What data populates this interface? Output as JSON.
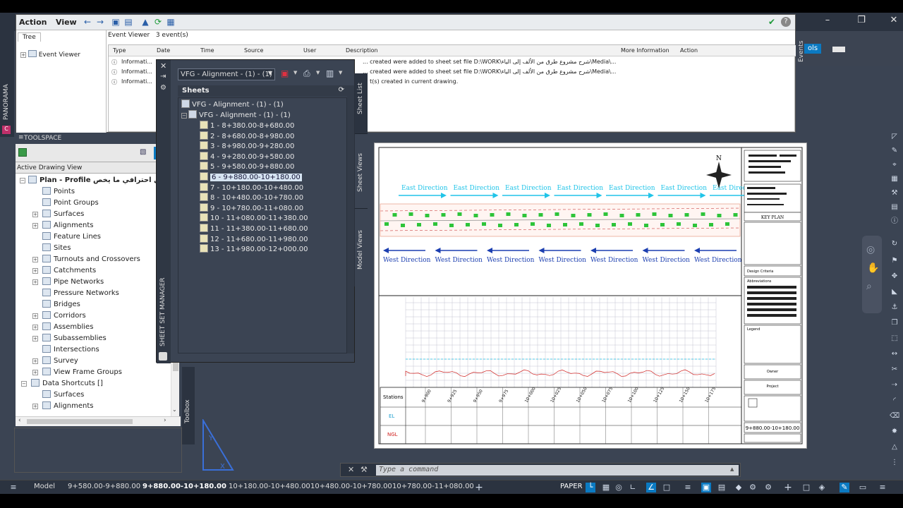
{
  "event_viewer": {
    "menu": {
      "action": "Action",
      "view": "View"
    },
    "tree_tab": "Tree",
    "tree_root": "Event Viewer",
    "header_title": "Event Viewer",
    "header_count": "3 event(s)",
    "columns": [
      "Type",
      "Date",
      "Time",
      "Source",
      "User",
      "Description",
      "More Information",
      "Action"
    ],
    "rows": [
      {
        "type": "Informati...",
        "description": "... created were added to sheet set file D:\\WORK\\شرح مشروع طرق من الألف إلى الياء\\Media\\..."
      },
      {
        "type": "Informati...",
        "description": "... created were added to sheet set file D:\\WORK\\شرح مشروع طرق من الألف إلى الياء\\Media\\..."
      },
      {
        "type": "Informati...",
        "description": "... t(s) created in current drawing."
      }
    ]
  },
  "ribbon": {
    "tab_label": "ols"
  },
  "panorama": {
    "label": "PANORAMA"
  },
  "toolspace": {
    "title": "TOOLSPACE",
    "view_title": "Active Drawing View",
    "root_label": "Plan - Profile بشكل احترافي ما يخص",
    "items": [
      "Points",
      "Point Groups",
      "Surfaces",
      "Alignments",
      "Feature Lines",
      "Sites",
      "Turnouts and Crossovers",
      "Catchments",
      "Pipe Networks",
      "Pressure Networks",
      "Bridges",
      "Corridors",
      "Assemblies",
      "Subassemblies",
      "Intersections",
      "Survey",
      "View Frame Groups"
    ],
    "shortcuts_label": "Data Shortcuts []",
    "shortcut_items": [
      "Surfaces",
      "Alignments"
    ]
  },
  "toolbox": {
    "label": "Toolbox"
  },
  "sheet_set": {
    "combo_value": "VFG - Alignment - (1) - (1)",
    "sheets_header": "Sheets",
    "root": "VFG - Alignment - (1) - (1)",
    "subset": "VFG - Alignment - (1) - (1)",
    "sheets": [
      "1 - 8+380.00-8+680.00",
      "2 - 8+680.00-8+980.00",
      "3 - 8+980.00-9+280.00",
      "4 - 9+280.00-9+580.00",
      "5 - 9+580.00-9+880.00",
      "6 - 9+880.00-10+180.00",
      "7 - 10+180.00-10+480.00",
      "8 - 10+480.00-10+780.00",
      "9 - 10+780.00-11+080.00",
      "10 - 11+080.00-11+380.00",
      "11 - 11+380.00-11+680.00",
      "12 - 11+680.00-11+980.00",
      "13 - 11+980.00-12+000.00"
    ],
    "selected_index": 5,
    "side_tabs": [
      "Sheet List",
      "Sheet Views",
      "Model Views"
    ],
    "manager_label": "SHEET SET MANAGER"
  },
  "drawing": {
    "east_labels": [
      "East Direction",
      "East Direction",
      "East Direction",
      "East Direction",
      "East Direction",
      "East Direction",
      "East Direction"
    ],
    "west_labels": [
      "West Direction",
      "West Direction",
      "West Direction",
      "West Direction",
      "West Direction",
      "West Direction",
      "West Direction"
    ],
    "north": "N",
    "key_plan": "KEY PLAN",
    "design_criteria": "Design Criteria",
    "abbreviations": "Abbreviations",
    "legend": "Legend",
    "owner": "Owner",
    "project": "Project",
    "stations_label": "Stations",
    "eg_label": "EL",
    "ngl_label": "NGL",
    "station_ticks": [
      "9+900",
      "9+925",
      "9+950",
      "9+975",
      "10+000",
      "10+025",
      "10+050",
      "10+075",
      "10+100",
      "10+125",
      "10+150",
      "10+175"
    ],
    "sheet_range": "9+880.00-10+180.00"
  },
  "command": {
    "placeholder": "Type a command"
  },
  "status": {
    "model_tab": "Model",
    "layout_tabs": [
      "9+580.00-9+880.00",
      "9+880.00-10+180.00",
      "10+180.00-10+480.00",
      "10+480.00-10+780.00",
      "10+780.00-11+080.00"
    ],
    "active_layout_index": 1,
    "paper": "PAPER"
  },
  "colors": {
    "accent": "#0b7ac2",
    "east": "#21c4e8",
    "west": "#1c3fb0",
    "ngl": "#d0201e"
  }
}
